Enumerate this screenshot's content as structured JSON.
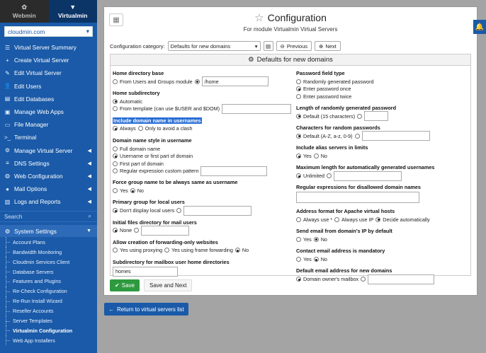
{
  "sidebar": {
    "tabs": [
      {
        "label": "Webmin",
        "icon": "webmin-icon"
      },
      {
        "label": "Virtualmin",
        "icon": "virtualmin-icon"
      }
    ],
    "server": "cloudmin.com",
    "menu": [
      {
        "label": "Virtual Server Summary",
        "icon": "list-icon",
        "glyph": "☰"
      },
      {
        "label": "Create Virtual Server",
        "icon": "plus-icon",
        "glyph": "+"
      },
      {
        "label": "Edit Virtual Server",
        "icon": "edit-icon",
        "glyph": "✎"
      },
      {
        "label": "Edit Users",
        "icon": "user-icon",
        "glyph": "👤"
      },
      {
        "label": "Edit Databases",
        "icon": "database-icon",
        "glyph": "▤"
      },
      {
        "label": "Manage Web Apps",
        "icon": "apps-icon",
        "glyph": "▣"
      },
      {
        "label": "File Manager",
        "icon": "folder-icon",
        "glyph": "▭"
      },
      {
        "label": "Terminal",
        "icon": "terminal-icon",
        "glyph": ">_"
      },
      {
        "label": "Manage Virtual Server",
        "icon": "gear-icon",
        "glyph": "⚙",
        "caret": "◀"
      },
      {
        "label": "DNS Settings",
        "icon": "dns-icon",
        "glyph": "≡",
        "caret": "◀"
      },
      {
        "label": "Web Configuration",
        "icon": "globe-icon",
        "glyph": "◍",
        "caret": "◀"
      },
      {
        "label": "Mail Options",
        "icon": "mail-icon",
        "glyph": "●",
        "caret": "◀"
      },
      {
        "label": "Logs and Reports",
        "icon": "chart-icon",
        "glyph": "▥",
        "caret": "◀"
      }
    ],
    "search_placeholder": "Search",
    "system_settings": {
      "label": "System Settings",
      "icon": "settings-icon",
      "caret": "▼"
    },
    "sub_items": [
      "Account Plans",
      "Bandwidth Monitoring",
      "Cloudmin Services Client",
      "Database Servers",
      "Features and Plugins",
      "Re-Check Configuration",
      "Re-Run Install Wizard",
      "Reseller Accounts",
      "Server Templates",
      "Virtualmin Configuration",
      "Web App Installers"
    ],
    "current_sub": "Virtualmin Configuration"
  },
  "header": {
    "title": "Configuration",
    "subtitle": "For module Virtualmin Virtual Servers"
  },
  "category": {
    "label": "Configuration category:",
    "selected": "Defaults for new domains",
    "previous": "Previous",
    "next": "Next"
  },
  "section_title": "Defaults for new domains",
  "left": {
    "home_base": {
      "label": "Home directory base",
      "opt1": "From Users and Groups module",
      "value": "/home"
    },
    "home_sub": {
      "label": "Home subdirectory",
      "opt1": "Automatic",
      "opt2": "From template (can use $USER and $DOM)"
    },
    "include_domain": {
      "label": "Include domain name in usernames",
      "opt1": "Always",
      "opt2": "Only to avoid a clash"
    },
    "name_style": {
      "label": "Domain name style in username",
      "opt1": "Full domain name",
      "opt2": "Username or first part of domain",
      "opt3": "First part of domain",
      "opt4": "Regular expression custom pattern"
    },
    "force_group": {
      "label": "Force group name to be always same as username",
      "yes": "Yes",
      "no": "No"
    },
    "primary_group": {
      "label": "Primary group for local users",
      "opt1": "Don't display local users"
    },
    "initial_files": {
      "label": "Initial files directory for mail users",
      "opt1": "None"
    },
    "forwarding": {
      "label": "Allow creation of forwarding-only websites",
      "opt1": "Yes using proxying",
      "opt2": "Yes using frame forwarding",
      "opt3": "No"
    },
    "subdir_mailbox": {
      "label": "Subdirectory for mailbox user home directories",
      "value": "homes"
    }
  },
  "right": {
    "pw_type": {
      "label": "Password field type",
      "opt1": "Randomly generated password",
      "opt2": "Enter password once",
      "opt3": "Enter password twice"
    },
    "pw_length": {
      "label": "Length of randomly generated password",
      "opt1": "Default (15 characters)"
    },
    "pw_chars": {
      "label": "Characters for random passwords",
      "opt1": "Default (A-Z, a-z, 0-9)"
    },
    "alias_limits": {
      "label": "Include alias servers in limits",
      "yes": "Yes",
      "no": "No"
    },
    "max_length": {
      "label": "Maximum length for automatically generated usernames",
      "opt1": "Unlimited"
    },
    "regex_disallowed": {
      "label": "Regular expressions for disallowed domain names"
    },
    "addr_format": {
      "label": "Address format for Apache virtual hosts",
      "opt1": "Always use *",
      "opt2": "Always use IP",
      "opt3": "Decide automatically"
    },
    "send_email": {
      "label": "Send email from domain's IP by default",
      "yes": "Yes",
      "no": "No"
    },
    "contact_email": {
      "label": "Contact email address is mandatory",
      "yes": "Yes",
      "no": "No"
    },
    "default_email": {
      "label": "Default email address for new domains",
      "opt1": "Domain owner's mailbox"
    }
  },
  "buttons": {
    "save": "Save",
    "save_next": "Save and Next",
    "return": "Return to virtual servers list"
  },
  "colors": {
    "sidebar": "#1a5aa8",
    "save": "#2e9a3f",
    "highlight": "#2a6fd6"
  }
}
